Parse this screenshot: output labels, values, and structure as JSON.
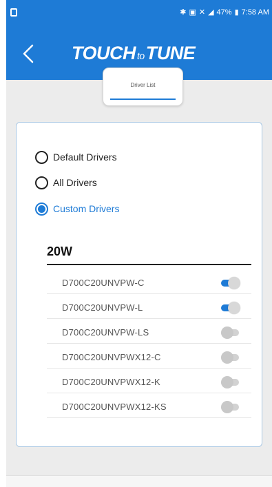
{
  "status_bar": {
    "battery": "47%",
    "time": "7:58 AM",
    "left_icon": "sim-card-icon",
    "icons": [
      "bluetooth-icon",
      "nfc-icon",
      "mute-icon",
      "signal-icon",
      "battery-icon"
    ]
  },
  "header": {
    "back_icon": "chevron-left-icon",
    "logo_part1": "TOUCH",
    "logo_part2": "to",
    "logo_part3": "TUNE"
  },
  "tab": {
    "label": "Driver List"
  },
  "options": [
    {
      "label": "Default Drivers",
      "selected": false
    },
    {
      "label": "All Drivers",
      "selected": false
    },
    {
      "label": "Custom Drivers",
      "selected": true
    }
  ],
  "group": {
    "title": "20W",
    "drivers": [
      {
        "name": "D700C20UNVPW-C",
        "enabled": true
      },
      {
        "name": "D700C20UNVPW-L",
        "enabled": true
      },
      {
        "name": "D700C20UNVPW-LS",
        "enabled": false
      },
      {
        "name": "D700C20UNVPWX12-C",
        "enabled": false
      },
      {
        "name": "D700C20UNVPWX12-K",
        "enabled": false
      },
      {
        "name": "D700C20UNVPWX12-KS",
        "enabled": false
      }
    ]
  },
  "colors": {
    "accent": "#1e7bd6",
    "background": "#ececec",
    "card_border": "#a9c8e4"
  }
}
